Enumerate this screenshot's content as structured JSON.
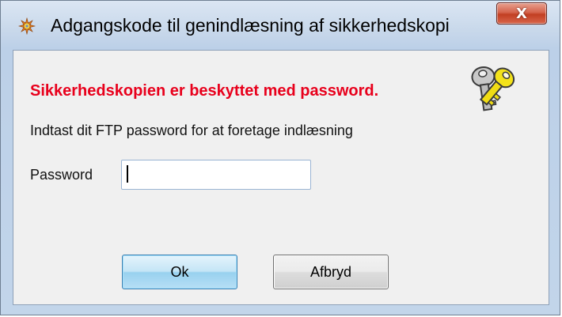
{
  "window": {
    "title": "Adgangskode til genindlæsning af sikkerhedskopi",
    "close_label": "X",
    "icon": "gear-sparkle-icon"
  },
  "dialog": {
    "heading": "Sikkerhedskopien er beskyttet med password.",
    "heading_color": "#e8001c",
    "instruction": "Indtast dit FTP password for at foretage indlæsning",
    "password_label": "Password",
    "password_value": "",
    "icon": "keys-icon"
  },
  "buttons": {
    "ok_label": "Ok",
    "cancel_label": "Afbryd"
  }
}
